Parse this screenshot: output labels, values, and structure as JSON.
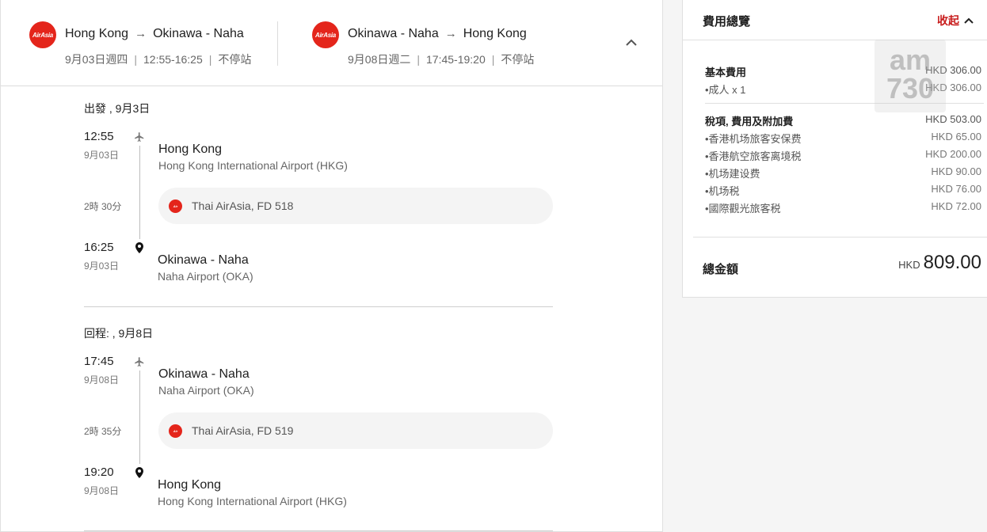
{
  "header": {
    "outbound": {
      "logo_text": "AirAsia",
      "from": "Hong Kong",
      "to": "Okinawa - Naha",
      "date": "9月03日週四",
      "time": "12:55-16:25",
      "stops": "不停站"
    },
    "return": {
      "logo_text": "AirAsia",
      "from": "Okinawa - Naha",
      "to": "Hong Kong",
      "date": "9月08日週二",
      "time": "17:45-19:20",
      "stops": "不停站"
    }
  },
  "itinerary": {
    "outbound": {
      "title": "出發 , 9月3日",
      "depart_time": "12:55",
      "depart_date": "9月03日",
      "depart_place": "Hong Kong",
      "depart_airport": "Hong Kong International Airport (HKG)",
      "duration": "2時 30分",
      "carrier": "Thai AirAsia, FD 518",
      "arrive_time": "16:25",
      "arrive_date": "9月03日",
      "arrive_place": "Okinawa - Naha",
      "arrive_airport": "Naha Airport (OKA)"
    },
    "return": {
      "title": "回程: , 9月8日",
      "depart_time": "17:45",
      "depart_date": "9月08日",
      "depart_place": "Okinawa - Naha",
      "depart_airport": "Naha Airport (OKA)",
      "duration": "2時 35分",
      "carrier": "Thai AirAsia, FD 519",
      "arrive_time": "19:20",
      "arrive_date": "9月08日",
      "arrive_place": "Hong Kong",
      "arrive_airport": "Hong Kong International Airport (HKG)"
    }
  },
  "price": {
    "title": "費用總覽",
    "collapse_label": "收起",
    "base": {
      "label": "基本費用",
      "amount": "HKD 306.00",
      "items": [
        {
          "label": "•成人 x 1",
          "amount": "HKD 306.00"
        }
      ]
    },
    "taxes": {
      "label": "稅項, 費用及附加費",
      "amount": "HKD 503.00",
      "items": [
        {
          "label": "•香港机场旅客安保费",
          "amount": "HKD 65.00"
        },
        {
          "label": "•香港航空旅客离境税",
          "amount": "HKD 200.00"
        },
        {
          "label": "•机场建设费",
          "amount": "HKD 90.00"
        },
        {
          "label": "•机场税",
          "amount": "HKD 76.00"
        },
        {
          "label": "•國際觀光旅客税",
          "amount": "HKD 72.00"
        }
      ]
    },
    "total_label": "總金額",
    "total_currency": "HKD",
    "total_value": "809.00"
  },
  "watermark": {
    "line1": "am",
    "line2": "730"
  },
  "colors": {
    "brand_red": "#e4251b",
    "collapse_red": "#c81c1c"
  }
}
